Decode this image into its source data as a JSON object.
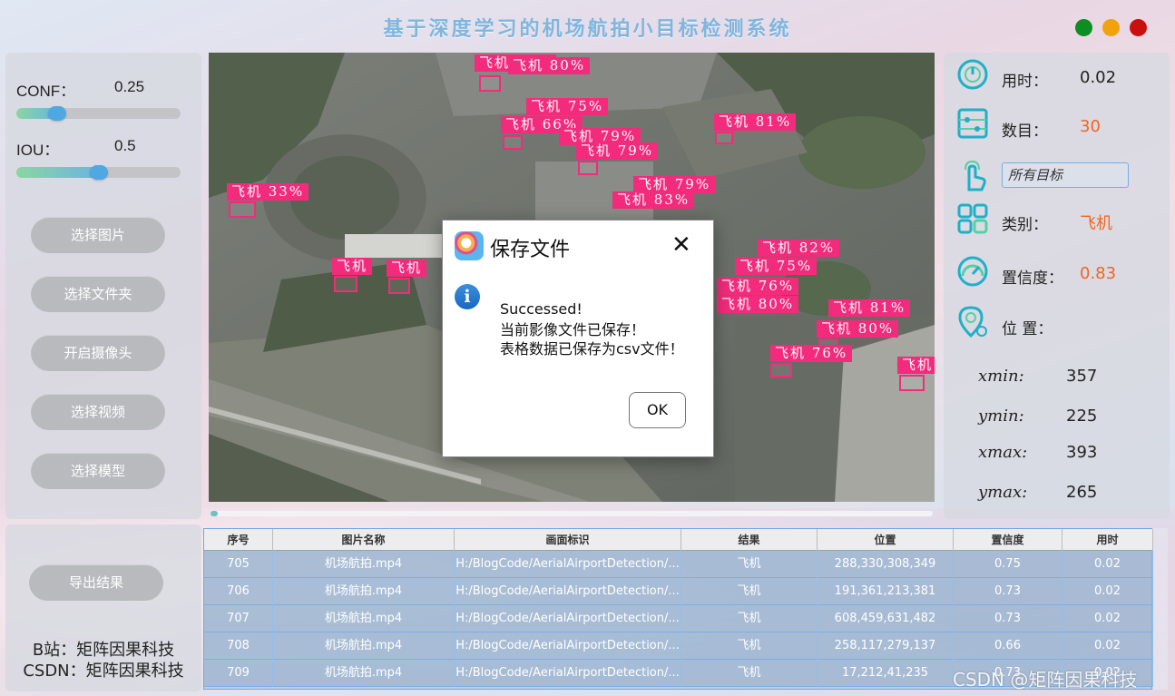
{
  "app": {
    "title": "基于深度学习的机场航拍小目标检测系统"
  },
  "params": {
    "conf_label": "CONF：",
    "conf_value": "0.25",
    "conf_fraction": 0.25,
    "iou_label": "IOU：",
    "iou_value": "0.5",
    "iou_fraction": 0.5
  },
  "buttons": {
    "select_image": "选择图片",
    "select_folder": "选择文件夹",
    "open_camera": "开启摄像头",
    "select_video": "选择视频",
    "select_model": "选择模型",
    "export": "导出结果"
  },
  "credits": {
    "bilibili": "B站：矩阵因果科技",
    "csdn": "CSDN：矩阵因果科技"
  },
  "detections": [
    {
      "label": "飞机 76%"
    },
    {
      "label": "飞机 80%"
    },
    {
      "label": "飞机 75%"
    },
    {
      "label": "飞机 66%"
    },
    {
      "label": "飞机 79%"
    },
    {
      "label": "飞机 79%"
    },
    {
      "label": "飞机 81%"
    },
    {
      "label": "飞机 33%"
    },
    {
      "label": "飞机 79%"
    },
    {
      "label": "飞机 83%"
    },
    {
      "label": "飞机"
    },
    {
      "label": "飞机"
    },
    {
      "label": "飞机 82%"
    },
    {
      "label": "飞机 75%"
    },
    {
      "label": "飞机 76%"
    },
    {
      "label": "飞机 80%"
    },
    {
      "label": "飞机 81%"
    },
    {
      "label": "飞机 80%"
    },
    {
      "label": "飞机 76%"
    },
    {
      "label": "飞机"
    }
  ],
  "video_progress": 0.01,
  "dialog": {
    "title": "保存文件",
    "close": "✕",
    "info_icon": "i",
    "line1": "Successed!",
    "line2": "当前影像文件已保存！",
    "line3": "表格数据已保存为csv文件！",
    "ok": "OK"
  },
  "info": {
    "time_label": "用时：",
    "time_value": "0.02",
    "count_label": "数目：",
    "count_value": "30",
    "target_select": "所有目标",
    "class_label": "类别：",
    "class_value": "飞机",
    "conf_label": "置信度：",
    "conf_value": "0.83",
    "position_label": "位 置：",
    "xmin_label": "xmin:",
    "xmin_value": "357",
    "ymin_label": "ymin:",
    "ymin_value": "225",
    "xmax_label": "xmax:",
    "xmax_value": "393",
    "ymax_label": "ymax:",
    "ymax_value": "265",
    "value_color": "#f0661e"
  },
  "table": {
    "headers": [
      "序号",
      "图片名称",
      "画面标识",
      "结果",
      "位置",
      "置信度",
      "用时"
    ],
    "rows": [
      [
        "705",
        "机场航拍.mp4",
        "H:/BlogCode/AerialAirportDetection/...",
        "飞机",
        "288,330,308,349",
        "0.75",
        "0.02"
      ],
      [
        "706",
        "机场航拍.mp4",
        "H:/BlogCode/AerialAirportDetection/...",
        "飞机",
        "191,361,213,381",
        "0.73",
        "0.02"
      ],
      [
        "707",
        "机场航拍.mp4",
        "H:/BlogCode/AerialAirportDetection/...",
        "飞机",
        "608,459,631,482",
        "0.73",
        "0.02"
      ],
      [
        "708",
        "机场航拍.mp4",
        "H:/BlogCode/AerialAirportDetection/...",
        "飞机",
        "258,117,279,137",
        "0.66",
        "0.02"
      ],
      [
        "709",
        "机场航拍.mp4",
        "H:/BlogCode/AerialAirportDetection/...",
        "飞机",
        "17,212,41,235",
        "0.73",
        "0.02"
      ]
    ]
  },
  "watermark": "CSDN @矩阵因果科技",
  "colors": {
    "title": "#7fb6de",
    "detection": "#f22b7d",
    "accent": "#4fa8e2"
  }
}
